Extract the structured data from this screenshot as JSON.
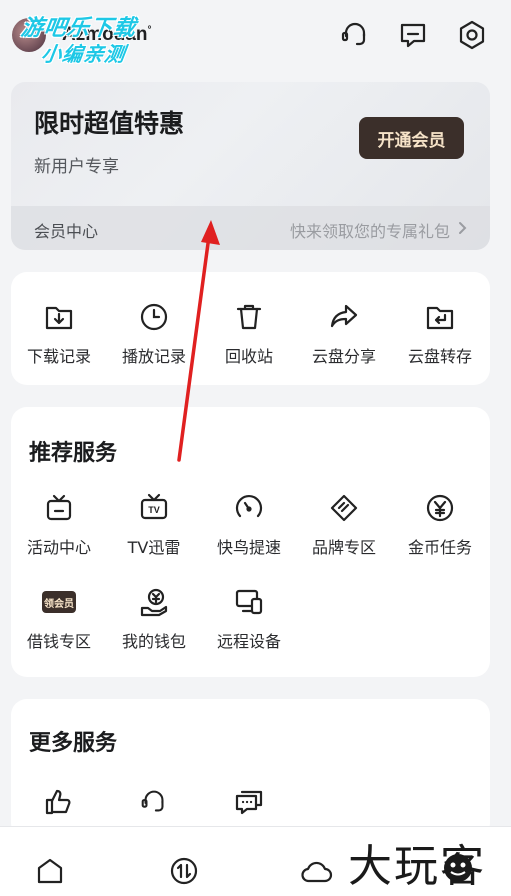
{
  "header": {
    "username": "Azmodan",
    "username_mark": "°",
    "watermark_line1": "游吧乐下载",
    "watermark_line2": "小编亲测",
    "icons": [
      "headset-icon",
      "message-icon",
      "settings-icon"
    ]
  },
  "promo": {
    "title": "限时超值特惠",
    "subtitle": "新用户专享",
    "button": "开通会员",
    "member_center": "会员中心",
    "gift_text": "快来领取您的专属礼包"
  },
  "quick_actions": [
    {
      "label": "下载记录",
      "icon": "download-folder-icon"
    },
    {
      "label": "播放记录",
      "icon": "clock-icon"
    },
    {
      "label": "回收站",
      "icon": "trash-icon"
    },
    {
      "label": "云盘分享",
      "icon": "share-arrow-icon"
    },
    {
      "label": "云盘转存",
      "icon": "folder-return-icon"
    }
  ],
  "recommended": {
    "title": "推荐服务",
    "items": [
      {
        "label": "活动中心",
        "icon": "activity-tv-icon"
      },
      {
        "label": "TV迅雷",
        "icon": "tv-icon"
      },
      {
        "label": "快鸟提速",
        "icon": "speedometer-icon"
      },
      {
        "label": "品牌专区",
        "icon": "brand-tag-icon"
      },
      {
        "label": "金币任务",
        "icon": "yen-coin-icon"
      },
      {
        "label": "借钱专区",
        "icon": "vip-badge-icon",
        "badge": "领会员"
      },
      {
        "label": "我的钱包",
        "icon": "wallet-hand-icon"
      },
      {
        "label": "远程设备",
        "icon": "remote-device-icon"
      }
    ]
  },
  "more": {
    "title": "更多服务",
    "items": [
      {
        "icon": "thumbs-up-icon"
      },
      {
        "icon": "headset-icon"
      },
      {
        "icon": "chat-feedback-icon"
      }
    ]
  },
  "bottom_nav": {
    "icons": [
      "home-icon",
      "transfer-icon",
      "cloud-icon"
    ],
    "watermark": "大玩客"
  },
  "colors": {
    "background": "#f3f4f6",
    "promo_button_bg": "#3b2f2a",
    "promo_button_text": "#f6e3c8",
    "annotation_arrow": "#e02020"
  }
}
